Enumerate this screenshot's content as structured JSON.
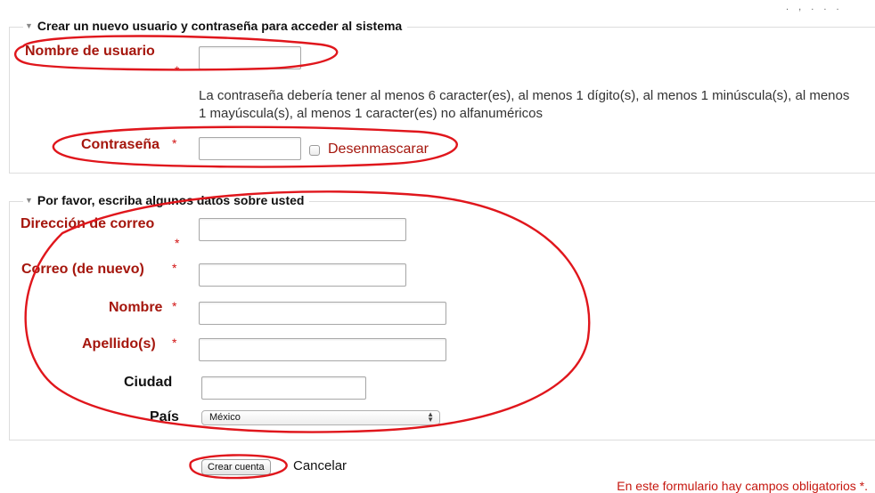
{
  "corner_text": ". , . . .",
  "section_account": {
    "legend": "Crear un nuevo usuario y contraseña para acceder al sistema",
    "username_label": "Nombre de usuario",
    "username_value": "",
    "password_policy": "La contraseña debería tener al menos 6 caracter(es), al menos 1 dígito(s), al menos 1 minúscula(s), al menos 1 mayúscula(s), al menos 1 caracter(es) no alfanuméricos",
    "password_label": "Contraseña",
    "password_value": "",
    "unmask_label": "Desenmascarar"
  },
  "section_profile": {
    "legend": "Por favor, escriba algunos datos sobre usted",
    "email_label": "Dirección de correo",
    "email_again_label": "Correo (de nuevo)",
    "firstname_label": "Nombre",
    "lastname_label": "Apellido(s)",
    "city_label": "Ciudad",
    "country_label": "País",
    "country_selected": "México"
  },
  "required_marker": "*",
  "actions": {
    "submit_label": "Crear cuenta",
    "cancel_label": "Cancelar"
  },
  "required_note": "En este formulario hay campos obligatorios *.",
  "colors": {
    "required_label": "#a5160d",
    "annotation": "#e0161c"
  }
}
